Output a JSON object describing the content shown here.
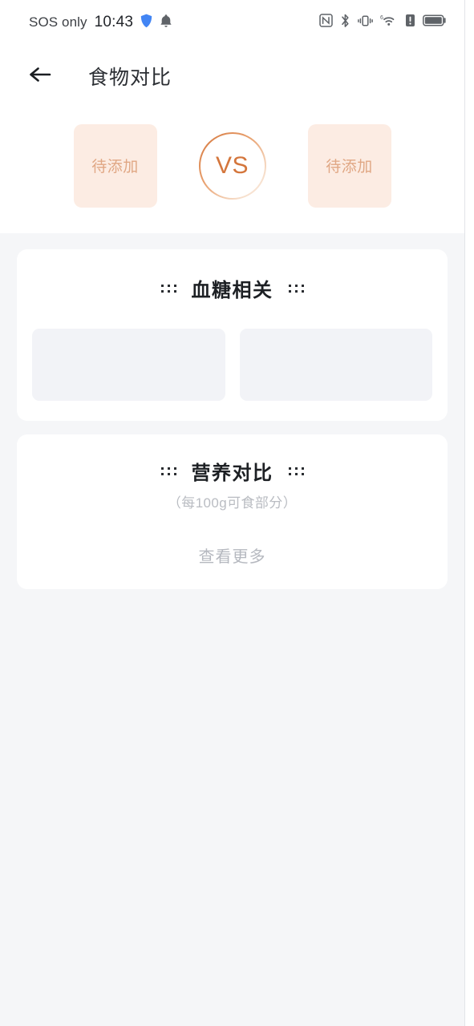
{
  "statusbar": {
    "carrier": "SOS only",
    "clock": "10:43",
    "icons_left": [
      "shield-icon",
      "bell-icon"
    ],
    "icons_right": [
      "nfc-icon",
      "bluetooth-icon",
      "vibrate-icon",
      "wifi6-icon",
      "alert-icon",
      "battery-icon"
    ],
    "shield_color": "#4285f4",
    "icon_color": "#5f6368"
  },
  "appbar": {
    "back_icon": "arrow-left-icon",
    "title": "食物对比"
  },
  "hero": {
    "left_slot_label": "待添加",
    "right_slot_label": "待添加",
    "vs_label": "VS",
    "slot_bg": "#fcece3",
    "slot_text_color": "#e0a784",
    "vs_color": "#d4763c"
  },
  "cards": [
    {
      "id": "bloodsugar",
      "title": "血糖相关",
      "subtitle": "",
      "ornament": "dots-ornament",
      "placeholders": 2
    },
    {
      "id": "nutrition",
      "title": "营养对比",
      "subtitle": "（每100g可食部分）",
      "ornament": "dots-ornament",
      "more_label": "查看更多"
    }
  ],
  "colors": {
    "page_bg": "#f5f6f8",
    "card_bg": "#ffffff",
    "placeholder_bg": "#f2f3f7",
    "title_color": "#1d2024",
    "muted_color": "#b9bcc2"
  }
}
